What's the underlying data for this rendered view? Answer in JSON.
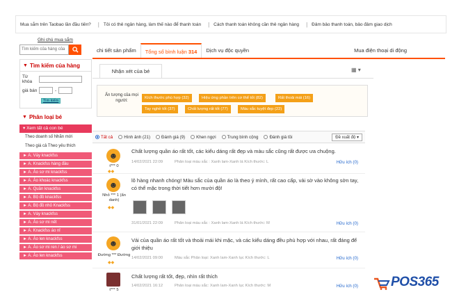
{
  "topbar": {
    "links": [
      "Mua sắm trên Taobao lần đầu tiên?",
      "Tôi có thẻ ngân hàng, làm thế nào để thanh toán",
      "Cách thanh toán không cần thẻ ngân hàng",
      "Đảm bảo thanh toán, bảo đảm giao dịch"
    ]
  },
  "guide_link": "Ghi chú mua sắm",
  "sidebar": {
    "search_placeholder": "Tìm kiếm của hàng của",
    "store_search_title": "Tìm kiếm của hàng",
    "keyword_label": "Từ khóa",
    "price_label": "giá bán",
    "price_sep": "-",
    "search_button": "Tìm kiếm",
    "category_title": "Phân loại bé",
    "selected_item": "Xem tất cả con bé",
    "text_items": [
      "Theo doanh số Nhãn mới",
      "Theo giá cả Theo yêu thích"
    ],
    "categories": [
      "A. Váy knackfss",
      "A. Knackfss hàng đầu",
      "A. Áo sơ mi knackfss",
      "A. Áo khoác knackfss",
      "A. Quần knackfss",
      "A. Bộ đồ knackfss",
      "A. Bộ đồ nhỏ Knackfss",
      "A. Váy knackfss",
      "A. Áo sơ mi nết",
      "A. Knackfss áo nỉ",
      "A. Áo len knackfss",
      "A. Áo sơ mi ren / áo sơ mi",
      "A. Áo len knackfss"
    ]
  },
  "tabs": {
    "details": "chi tiết sản phẩm",
    "reviews": "Tổng số bình luận",
    "reviews_count": "314",
    "service": "Dịch vụ độc quyền",
    "mobile": "Mua điện thoại di động"
  },
  "panel": {
    "subtab": "Nhận xét của bé",
    "impression_label": "Ấn tượng của mọi người:",
    "chips": [
      "Kích thước phù hợp (32)",
      "Hiệu ứng phần trên cơ thể tốt (82)",
      "Rất thoải mái (16)",
      "Tay nghề tốt (37)",
      "Chất lượng rất tốt (77)",
      "Màu sắc tuyệt đẹp (22)"
    ],
    "filters": [
      "Tất cả",
      "Hình ảnh (21)",
      "Đánh giá (9)",
      "Khen ngợi",
      "Trung bình cộng",
      "Đánh giá tồi"
    ],
    "sort_label": "Đề xuất độ ▾"
  },
  "reviews": [
    {
      "name": "t*** 0",
      "text": "Chất lượng quần áo rất tốt, các kiểu dáng rất đẹp và màu sắc cũng rất được ưa chuộng.",
      "date": "14/02/2021 22:09",
      "options": "Phân loại màu sắc : Xanh lam-Xanh lá Kích thước: L",
      "help": "Hữu ích (0)"
    },
    {
      "name": "Nhỏ *** 1 (ẩn danh)",
      "text": "lô hàng nhanh chóng! Màu sắc của quần áo là theo ý mình, rất cao cấp, vải sờ vào không sờn tay, có thể mặc trong thời tiết hơn mười độ!",
      "date": "31/01/2021 22:09",
      "options": "Phân loại màu sắc : Xanh lam-Xanh lá Kích thước: M",
      "help": "Hữu ích (0)"
    },
    {
      "name": "Đường *** Đường",
      "text": "Vải của quần áo rất tốt và thoải mái khi mặc, và các kiểu dáng đều phù hợp với nhau, rất đáng để giới thiệu",
      "date": "14/02/2021 09:00",
      "options": "Màu sắc Phân loại: Xanh lam-Xanh lục Kích thước: L",
      "help": "Hữu ích (0)"
    },
    {
      "name": "t*** 5",
      "text": "Chất lượng rất tốt, đẹp, nhìn rất thích",
      "date": "14/02/2021 16:12",
      "options": "Phân loại màu sắc: Xanh lam-Xanh lục Kích thước: M",
      "help": "Hữu ích (0)"
    }
  ],
  "logo_text": "POS365",
  "colors": {
    "accent": "#ff5000",
    "chip": "#f4a018",
    "category": "#f05a78",
    "logo": "#1f4fa8"
  },
  "icons": [
    "search-icon",
    "grid-view-icon",
    "smiley-avatar-icon",
    "arrow-right-icon"
  ]
}
